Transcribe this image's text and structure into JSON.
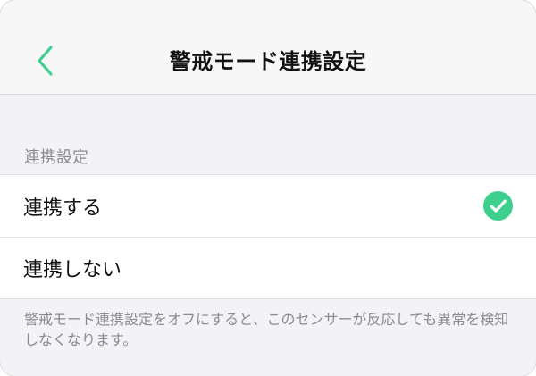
{
  "nav": {
    "title": "警戒モード連携設定",
    "back_icon": "chevron-left-icon",
    "accent_color": "#3ccf8e"
  },
  "section": {
    "header": "連携設定"
  },
  "options": [
    {
      "label": "連携する",
      "selected": true
    },
    {
      "label": "連携しない",
      "selected": false
    }
  ],
  "footer": {
    "note": "警戒モード連携設定をオフにすると、このセンサーが反応しても異常を検知しなくなります。"
  },
  "colors": {
    "background": "#f2f2f7",
    "check": "#3ccf8e"
  }
}
